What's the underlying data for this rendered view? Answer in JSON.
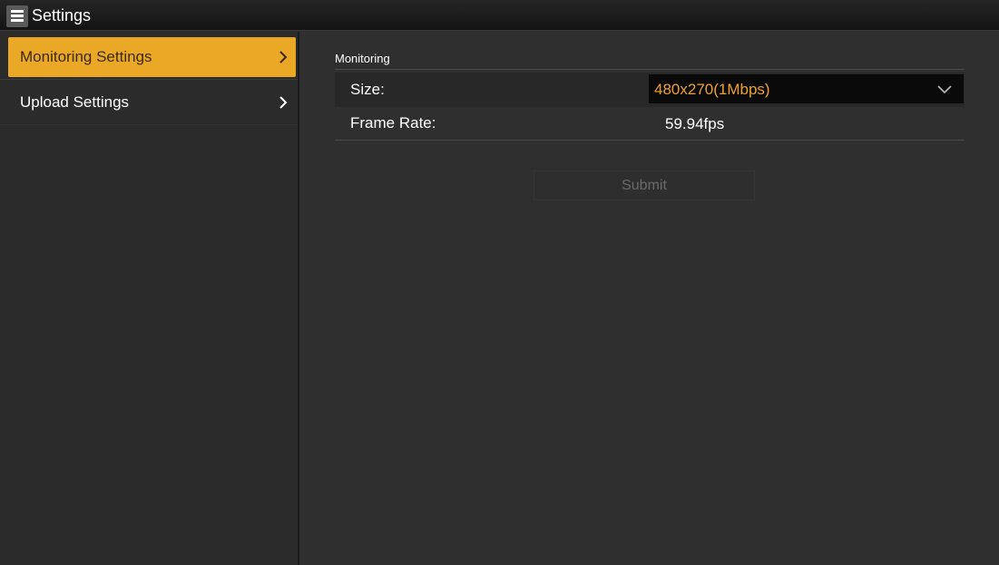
{
  "app": {
    "title": "Settings"
  },
  "sidebar": {
    "items": [
      {
        "label": "Monitoring Settings",
        "active": true
      },
      {
        "label": "Upload Settings",
        "active": false
      }
    ]
  },
  "main": {
    "section_title": "Monitoring",
    "size": {
      "label": "Size:",
      "selected": "480x270(1Mbps)"
    },
    "frame_rate": {
      "label": "Frame Rate:",
      "value": "59.94fps"
    },
    "submit_label": "Submit"
  },
  "colors": {
    "accent": "#eba826",
    "select_text": "#f0a030",
    "background": "#2d2d2d"
  },
  "icons": [
    "menu-icon",
    "chevron-right-icon",
    "chevron-down-icon"
  ]
}
